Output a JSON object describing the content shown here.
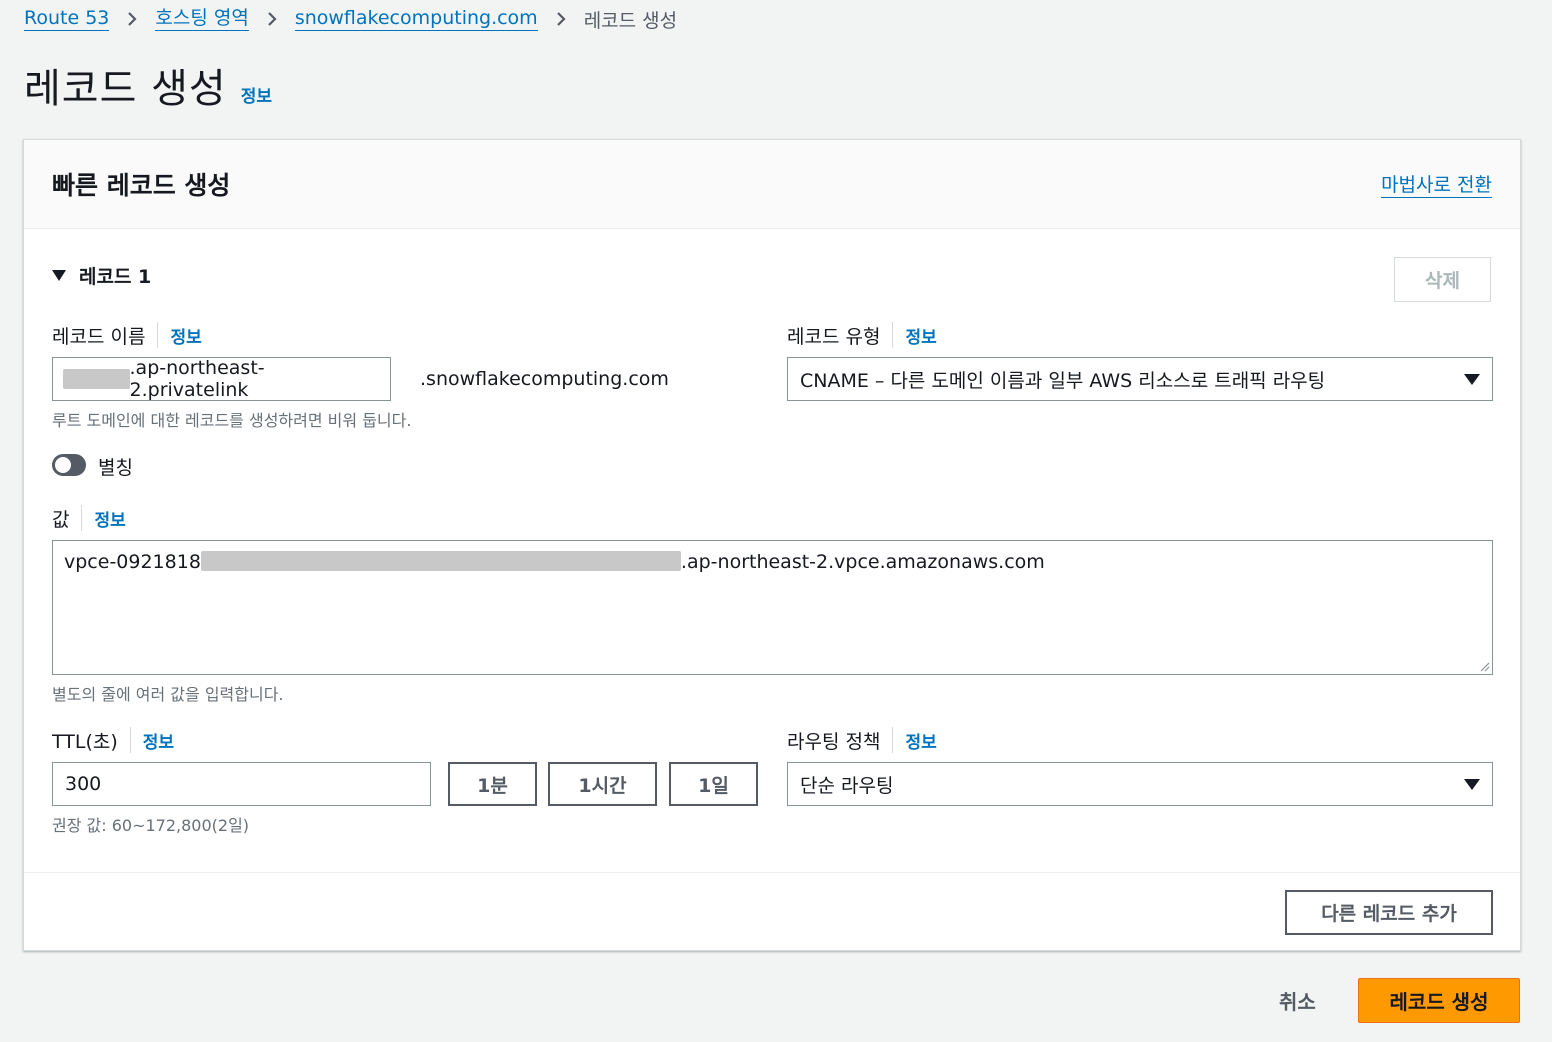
{
  "breadcrumb": {
    "items": [
      "Route 53",
      "호스팅 영역",
      "snowflakecomputing.com"
    ],
    "current": "레코드 생성"
  },
  "page": {
    "title": "레코드 생성",
    "info": "정보"
  },
  "panel": {
    "title": "빠른 레코드 생성",
    "wizard_link": "마법사로 전환",
    "record_section": "레코드 1",
    "delete_label": "삭제",
    "record_name": {
      "label": "레코드 이름",
      "info": "정보",
      "value_suffix": ".ap-northeast-2.privatelink",
      "domain_suffix": ".snowflakecomputing.com",
      "hint": "루트 도메인에 대한 레코드를 생성하려면 비워 둡니다."
    },
    "record_type": {
      "label": "레코드 유형",
      "info": "정보",
      "selected": "CNAME – 다른 도메인 이름과 일부 AWS 리소스로 트래픽 라우팅"
    },
    "alias": {
      "label": "별칭",
      "enabled": false
    },
    "value": {
      "label": "값",
      "info": "정보",
      "prefix": "vpce-0921818",
      "suffix": ".ap-northeast-2.vpce.amazonaws.com",
      "hint": "별도의 줄에 여러 값을 입력합니다."
    },
    "ttl": {
      "label": "TTL(초)",
      "info": "정보",
      "value": "300",
      "presets": [
        "1분",
        "1시간",
        "1일"
      ],
      "hint": "권장 값: 60~172,800(2일)"
    },
    "routing_policy": {
      "label": "라우팅 정책",
      "info": "정보",
      "selected": "단순 라우팅"
    },
    "add_record_label": "다른 레코드 추가"
  },
  "actions": {
    "cancel": "취소",
    "create": "레코드 생성"
  },
  "colors": {
    "link": "#0073bb",
    "primary": "#ff9900",
    "background": "#f2f3f3"
  }
}
